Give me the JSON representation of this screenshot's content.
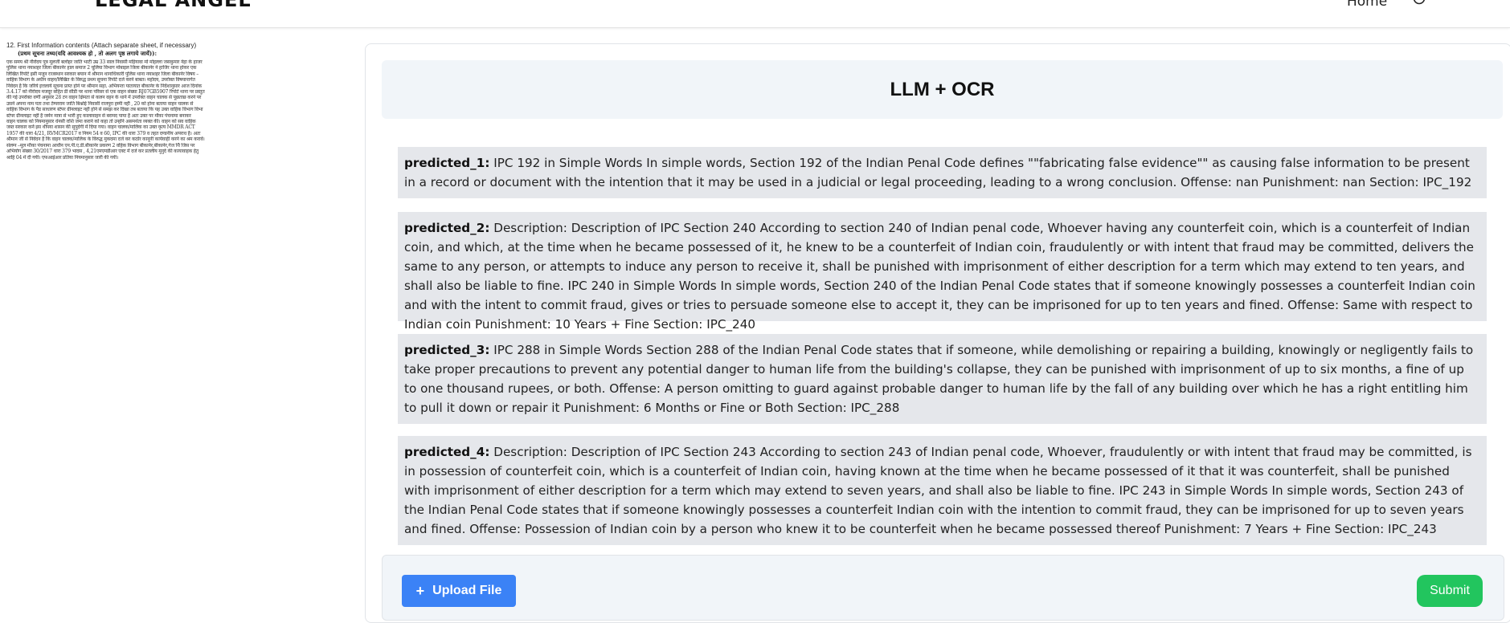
{
  "header": {
    "logo": "LEGAL ANGEL",
    "nav_home": "Home"
  },
  "document": {
    "title": "12. First Information contents (Attach separate sheet, if necessary)",
    "subtitle": "(प्रथम सूचना तथ्य(यदि आवश्यक हो , तो अलग पृष्ठ लगाये जायें)):",
    "lines": [
      "एक समय श्री नीरोदय पुत्र मूलजी बलोहर जाति भाटी उम्र 33 साल निवासी महियावा मो मोहल्ला जसकुमार नेहा के हाजर",
      "पुलिस थाना नयाशहर जिला बीकानेर हाल समाज 2 चूलिया विभाग मोबाइल जिला बीकानेर ने हाजिर थाना होकर एक",
      "लिखित रिपोर्ट इसी मजून राजस्थान सरकार बयान में श्रीमान थानाधिकारी पुलिस थाना नयाशहर जिला बीकानेर विषय –",
      "वाहिक विभाग के अधीन वाहन/लिखित के विरुद्ध प्रथम सूचना रिपोर्ट दर्ज करने बाबत। महोदय, उपरोक्त विषयान्तर्गत",
      "निवेदन है कि जरिये इत्तलाये सूचना प्राप्त होने पर श्रीमान सहा. अभियन्ता यातायात बीकानेर के निर्देशानुसार आज दिनांक",
      "3.4.17 को नीरोदय मजदूर सहित डी सीडी पर थाना परिसर से एक वाहन संख्या RJ07GB5907 रिपोर्ट थाना पर प्रस्तुत",
      "की गई उपरोक्त वर्णी अनुसार 28 टन वाहन क्षिमता से कलन वहन के थाने में उपरोक्त वाहन चालक से पूछताछ करने पर",
      "उसने अपना नाम पता तथा टेम्परराम जाति बिश्नोई निवासी राजपुरा हम्मी नहीं , 20 को होना बताया वाहन चालक से",
      "वाहिक विभाग के पैड साधारण स्टेपर ग्रीनलाइट नहीं होने से समझ कर दिखा तब बताया कि यह उक्त वाहिक विभाग विभा",
      "स्टेपर ग्रीनलाइट नहीं है जर्मन मात्रा से भारी हुए कालावाहन से बरामद पाया है अतः उक्त पर मौका पंचनामा बनाकर",
      "वाहन चालक को नियमानुसार धेनसी राशि जमा कराने को कहा तो उन्होंने असमर्थता व्यक्त की। वाहन को सव वाहिक",
      "जब्त सरकार कर्ने इस थीपया शासन की सुपुर्दगी में दिया गया। वाहन चालक/मालिक का उक्त कृत्य MMDR ACT",
      "1957 की धारा 4/21, RVMCR2017 व नियम 54 व 60, IPC की धारा 379 व तहत दण्डनीय अपराध है। अतः",
      "श्रीमान जी से निवेदन है कि वाहन चालक/मालिक के विरुद्ध मुकदमा दर्ज कर कठोर कानूनी कार्यवाही करने का श्रम करावें।",
      "संलग्न –मूल मौका पंचनामा आधीन एन.पी.ए.डी.बीकानेर प्रकरण 2 वहिक विभाग बीकानेर,बीकानेर,गेज थैि जिस पर",
      "अभियोग संख्या 30/2017 धारा 379 भादस , 4,21एमएमडीआर एक्ट में दर्ज कर प्रतलीय मुनुर्द की कायावाहक हेतु",
      "श्राहि 04 में दी गयी। एफआईआर प्रतिया नियमानुसार जारी की गयी।"
    ]
  },
  "main": {
    "title": "LLM + OCR",
    "predictions": [
      {
        "label": "predicted_1:",
        "text": " IPC 192 in Simple Words In simple words, Section 192 of the Indian Penal Code defines \"\"fabricating false evidence\"\" as causing false information to be present in a record or document with the intention that it may be used in a judicial or legal proceeding, leading to a wrong conclusion. Offense: nan Punishment: nan Section: IPC_192"
      },
      {
        "label": "predicted_2:",
        "text": " Description: Description of IPC Section 240 According to section 240 of Indian penal code, Whoever having any counterfeit coin, which is a counterfeit of Indian coin, and which, at the time when he became possessed of it, he knew to be a counterfeit of Indian coin, fraudulently or with intent that fraud may be committed, delivers the same to any person, or attempts to induce any person to receive it, shall be punished with imprisonment of either description for a term which may extend to ten years, and shall also be liable to fine. IPC 240 in Simple Words In simple words, Section 240 of the Indian Penal Code states that if someone knowingly possesses a counterfeit Indian coin and with the intent to commit fraud, gives or tries to persuade someone else to accept it, they can be imprisoned for up to ten years and fined. Offense: Same with respect to Indian coin Punishment: 10 Years + Fine Section: IPC_240"
      },
      {
        "label": "predicted_3:",
        "text": " IPC 288 in Simple Words Section 288 of the Indian Penal Code states that if someone, while demolishing or repairing a building, knowingly or negligently fails to take proper precautions to prevent any potential danger to human life from the building's collapse, they can be punished with imprisonment of up to six months, a fine of up to one thousand rupees, or both. Offense: A person omitting to guard against probable danger to human life by the fall of any building over which he has a right entitling him to pull it down or repair it Punishment: 6 Months or Fine or Both Section: IPC_288"
      },
      {
        "label": "predicted_4:",
        "text": " Description: Description of IPC Section 243 According to section 243 of Indian penal code, Whoever, fraudulently or with intent that fraud may be committed, is in possession of counterfeit coin, which is a counterfeit of Indian coin, having known at the time when he became possessed of it that it was counterfeit, shall be punished with imprisonment of either description for a term which may extend to seven years, and shall also be liable to fine. IPC 243 in Simple Words In simple words, Section 243 of the Indian Penal Code states that if someone knowingly possesses a counterfeit Indian coin with the intention to commit fraud, they can be imprisoned for up to seven years and fined. Offense: Possession of Indian coin by a person who knew it to be counterfeit when he became possessed thereof Punishment: 7 Years + Fine Section: IPC_243"
      }
    ]
  },
  "actions": {
    "upload_icon": "+",
    "upload_label": "Upload File",
    "submit_label": "Submit",
    "upload_color": "#3b82f6",
    "submit_color": "#22c55e"
  }
}
